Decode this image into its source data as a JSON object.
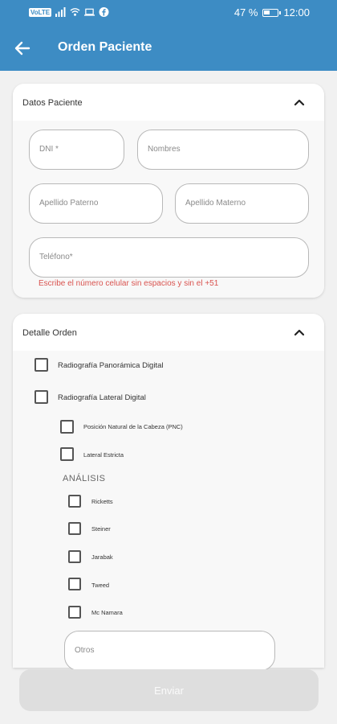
{
  "status_bar": {
    "sim_badge": "VoLTE",
    "battery": "47 %",
    "battery_level": 0.47,
    "time": "12:00"
  },
  "app_bar": {
    "back_icon": "arrow-left-icon",
    "title": "Orden Paciente"
  },
  "patient_section": {
    "title": "Datos Paciente",
    "expanded": true,
    "fields": {
      "dni": {
        "placeholder": "DNI *",
        "value": ""
      },
      "nombres": {
        "placeholder": "Nombres",
        "value": ""
      },
      "apellido_paterno": {
        "placeholder": "Apellido Paterno",
        "value": ""
      },
      "apellido_materno": {
        "placeholder": "Apellido Materno",
        "value": ""
      },
      "telefono": {
        "placeholder": "Teléfono*",
        "value": ""
      }
    },
    "phone_hint": "Escribe el número celular sin espacios y sin el +51"
  },
  "order_section": {
    "title": "Detalle Orden",
    "expanded": true,
    "main_options": [
      {
        "label": "Radiografía Panorámica Digital",
        "checked": false
      },
      {
        "label": "Radiografía Lateral Digital",
        "checked": false
      }
    ],
    "lateral_options": [
      {
        "label": "Posición Natural de la Cabeza (PNC)",
        "checked": false
      },
      {
        "label": "Lateral Estricta",
        "checked": false
      }
    ],
    "analysis_title": "ANÁLISIS",
    "analysis_options": [
      {
        "label": "Ricketts",
        "checked": false
      },
      {
        "label": "Steiner",
        "checked": false
      },
      {
        "label": "Jarabak",
        "checked": false
      },
      {
        "label": "Tweed",
        "checked": false
      },
      {
        "label": "Mc Namara",
        "checked": false
      }
    ],
    "otros": {
      "placeholder": "Otros",
      "value": ""
    }
  },
  "submit": {
    "label": "Enviar",
    "enabled": false
  },
  "colors": {
    "primary": "#3d8cc4",
    "hint_red": "#d9534f",
    "disabled_button": "#dedede"
  }
}
